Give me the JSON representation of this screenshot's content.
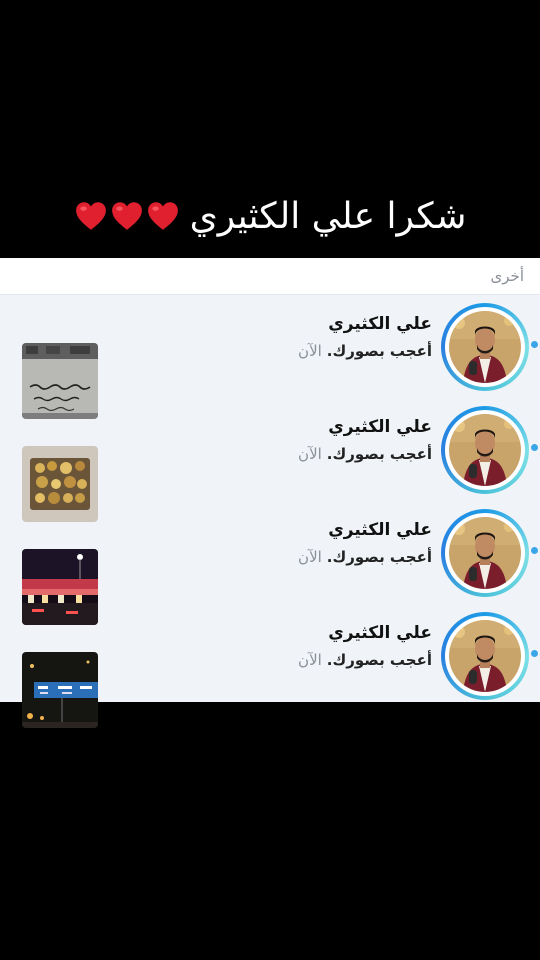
{
  "overlay": {
    "caption": "شكرا علي الكثيري",
    "hearts": [
      "red-heart-emoji",
      "red-heart-emoji",
      "red-heart-emoji"
    ],
    "heart_color": "#e0202e"
  },
  "activity": {
    "section_title": "أخرى",
    "ring_colors": [
      "#1e9be6",
      "#7ee0e6"
    ],
    "unread_color": "#3aa6e8",
    "notifications": [
      {
        "user": "علي الكثيري",
        "action": "أعجب بصورك.",
        "time": "الآن",
        "thumbnail": "graffiti-wall-text",
        "avatar": "profile-photo"
      },
      {
        "user": "علي الكثيري",
        "action": "أعجب بصورك.",
        "time": "الآن",
        "thumbnail": "gold-jewelry-tray",
        "avatar": "profile-photo"
      },
      {
        "user": "علي الكثيري",
        "action": "أعجب بصورك.",
        "time": "الآن",
        "thumbnail": "night-city-road",
        "avatar": "profile-photo"
      },
      {
        "user": "علي الكثيري",
        "action": "أعجب بصورك.",
        "time": "الآن",
        "thumbnail": "highway-sign-night",
        "avatar": "profile-photo"
      }
    ]
  }
}
